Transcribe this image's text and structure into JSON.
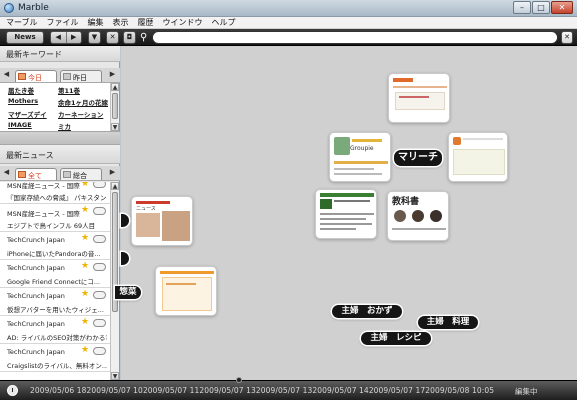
{
  "window": {
    "title": "Marble",
    "buttons": {
      "minimize": "–",
      "maximize": "□",
      "close": "✕"
    }
  },
  "menu": [
    "マーブル",
    "ファイル",
    "編集",
    "表示",
    "履歴",
    "ウインドウ",
    "ヘルプ"
  ],
  "toolbar": {
    "news_label": "News",
    "back": "◀",
    "forward": "▶",
    "dropdown": "▼",
    "stop": "✕",
    "screenshot": "◘",
    "url_value": "",
    "close": "✕"
  },
  "keywords": {
    "title": "最新キーワード",
    "tabs": [
      {
        "label": "今日",
        "active": true
      },
      {
        "label": "昨日",
        "active": false
      }
    ],
    "items": [
      [
        "届たき巻",
        "第11巻"
      ],
      [
        "Mothers",
        "余命1ヶ月の花嫁"
      ],
      [
        "マザーズデイ",
        "カーネーション"
      ],
      [
        "IMAGE",
        "ミカ"
      ]
    ]
  },
  "news": {
    "title": "最新ニュース",
    "tabs": [
      {
        "label": "全て",
        "active": true
      },
      {
        "label": "総合",
        "active": false
      }
    ],
    "items": [
      {
        "source": "MSN産経ニュース - 国際",
        "title": "『国家存続への脅威』 パキスタン..."
      },
      {
        "source": "MSN産経ニュース - 国際",
        "title": "エジプトで鳥インフル 69人目"
      },
      {
        "source": "TechCrunch Japan",
        "title": "iPhoneに届いたPandoraの音..."
      },
      {
        "source": "TechCrunch Japan",
        "title": "Google Friend Connectにコ..."
      },
      {
        "source": "TechCrunch Japan",
        "title": "仮想アバターを用いたウィジェ..."
      },
      {
        "source": "TechCrunch Japan",
        "title": "AD: ライバルのSEO対策がわかる?"
      },
      {
        "source": "TechCrunch Japan",
        "title": "Craigslistのライバル、無料オン..."
      }
    ]
  },
  "canvas": {
    "pills": {
      "marichi": "マリーチ",
      "shufu_okazu": "主婦　おかず",
      "shufu_ryouri": "主婦　料理",
      "shufu_reshipi": "主婦　レシピ",
      "left_partial": "惣菜"
    },
    "thumbnails": {
      "kyokasho_heading": "教科書",
      "groupie_label": "Groupie",
      "news_heading": "ニュース"
    }
  },
  "timeline": {
    "ticks": [
      "2009/05/06 18",
      "2009/05/07 10",
      "2009/05/07 11",
      "2009/05/07 13",
      "2009/05/07 13",
      "2009/05/07 14",
      "2009/05/07 17",
      "2009/05/08 10:05"
    ],
    "status": "編集中"
  }
}
